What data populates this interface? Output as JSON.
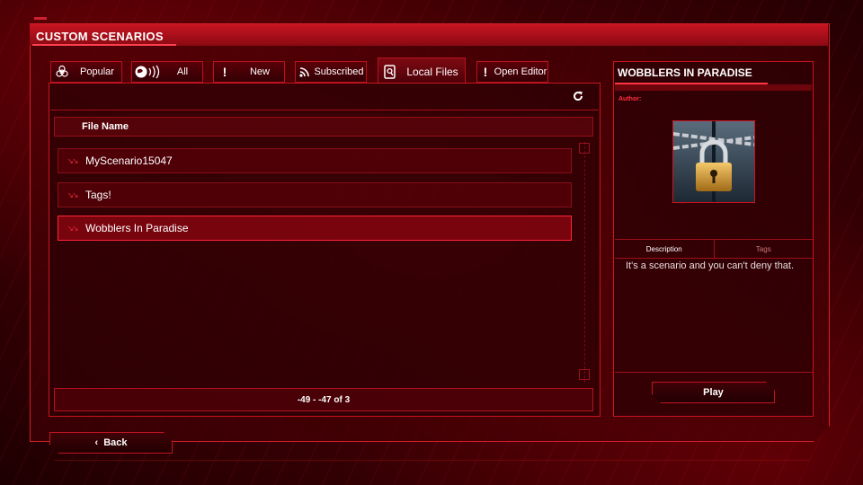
{
  "header": {
    "title": "CUSTOM SCENARIOS"
  },
  "tabs": [
    {
      "label": "Popular",
      "icon": "biohazard-icon"
    },
    {
      "label": "All",
      "icon": "globe-broadcast-icon"
    },
    {
      "label": "New",
      "icon": "exclamation-icon"
    },
    {
      "label": "Subscribed",
      "icon": "rss-icon"
    },
    {
      "label": "Local Files",
      "icon": "file-icon",
      "active": true
    },
    {
      "label": "Open Editor",
      "icon": "exclamation-icon"
    }
  ],
  "list": {
    "column_header": "File Name",
    "rows": [
      {
        "name": "MyScenario15047"
      },
      {
        "name": "Tags!"
      },
      {
        "name": "Wobblers In Paradise",
        "selected": true
      }
    ],
    "pager": "-49 - -47 of 3",
    "refresh_icon": "refresh-icon"
  },
  "detail": {
    "title": "WOBBLERS IN PARADISE",
    "author_label": "Author:",
    "thumbnail_icon": "padlock-chains-icon",
    "tabs": [
      "Description",
      "Tags"
    ],
    "description": "It's a scenario and you can't deny that.",
    "play_label": "Play"
  },
  "footer": {
    "back_label": "Back"
  },
  "colors": {
    "accent": "#d4202a",
    "highlight": "#ff2636",
    "background": "#3a0004"
  }
}
